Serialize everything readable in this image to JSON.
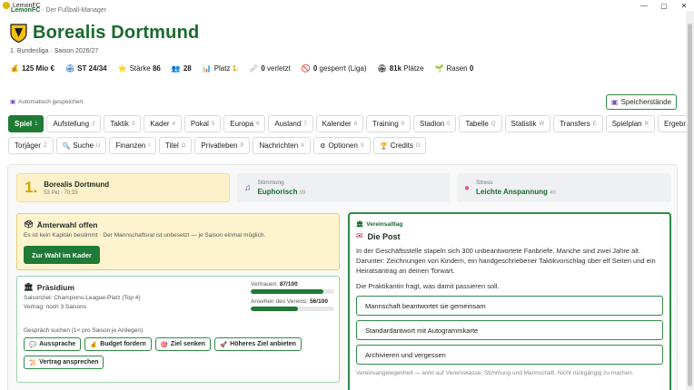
{
  "window": {
    "title": "LemonFC",
    "min": "—",
    "max": "▢",
    "close": "✕"
  },
  "brand": {
    "name": "LemonFC",
    "tagline": "· Der Fußball-Manager"
  },
  "club": {
    "name": "Borealis Dortmund",
    "league_season": "1. Bundesliga · Saison 2026/27"
  },
  "stats": [
    {
      "icon": "money-bag-icon",
      "glyph": "💰",
      "value": "125 Mio €",
      "label": ""
    },
    {
      "icon": "stadium-icon",
      "glyph": "🏟",
      "value": "ST 24/34",
      "label": ""
    },
    {
      "icon": "star-icon",
      "glyph": "⭐",
      "value": "86",
      "label": "Stärke"
    },
    {
      "icon": "players-icon",
      "glyph": "👥",
      "value": "28",
      "label": ""
    },
    {
      "icon": "chart-icon",
      "glyph": "📊",
      "value": "1.",
      "label": "Platz"
    },
    {
      "icon": "injury-icon",
      "glyph": "🩹",
      "value": "0",
      "label": "verletzt"
    },
    {
      "icon": "ban-icon",
      "glyph": "🚫",
      "value": "0",
      "label": "gesperrt (Liga)"
    },
    {
      "icon": "seats-icon",
      "glyph": "🏟",
      "value": "81k",
      "label": "Plätze"
    },
    {
      "icon": "grass-icon",
      "glyph": "🌱",
      "value": "0",
      "label": "Rasen"
    }
  ],
  "autosave": "Automatisch gespeichert",
  "save_button": "Speicherstände",
  "nav_row1": [
    {
      "label": "Spiel",
      "key": "1",
      "active": true
    },
    {
      "label": "Aufstellung",
      "key": "2"
    },
    {
      "label": "Taktik",
      "key": "3"
    },
    {
      "label": "Kader",
      "key": "4"
    },
    {
      "label": "Pokal",
      "key": "5"
    },
    {
      "label": "Europa",
      "key": "6"
    },
    {
      "label": "Ausland",
      "key": "7"
    },
    {
      "label": "Kalender",
      "key": "8"
    },
    {
      "label": "Training",
      "key": "9"
    },
    {
      "label": "Stadion",
      "key": "0"
    },
    {
      "label": "Tabelle",
      "key": "Q"
    },
    {
      "label": "Statistik",
      "key": "W"
    },
    {
      "label": "Transfers",
      "key": "E"
    },
    {
      "label": "Spielplan",
      "key": "R"
    },
    {
      "label": "Ergebnisse",
      "key": "T"
    }
  ],
  "nav_row2": [
    {
      "label": "Torjäger",
      "key": "Z",
      "glyph": ""
    },
    {
      "label": "Suche",
      "key": "U",
      "glyph": "🔍"
    },
    {
      "label": "Finanzen",
      "key": "I",
      "glyph": ""
    },
    {
      "label": "Titel",
      "key": "O",
      "glyph": ""
    },
    {
      "label": "Privatleben",
      "key": "P",
      "glyph": ""
    },
    {
      "label": "Nachrichten",
      "key": "A",
      "glyph": ""
    },
    {
      "label": "Optionen",
      "key": "S",
      "glyph": "⚙"
    },
    {
      "label": "Credits",
      "key": "D",
      "glyph": "🏆"
    }
  ],
  "cards": {
    "rank": {
      "num": "1.",
      "club": "Borealis Dortmund",
      "meta": "53 Pkt · 70:33"
    },
    "mood": {
      "label": "Stimmung",
      "value": "Euphorisch",
      "score": "99"
    },
    "stress": {
      "label": "Stress",
      "value": "Leichte Anspannung",
      "score": "40"
    }
  },
  "election": {
    "title": "Ämterwahl offen",
    "text": "Es ist kein Kapitän bestimmt · Der Mannschaftsrat ist unbesetzt — je Saison einmal möglich.",
    "button": "Zur Wahl im Kader"
  },
  "presidium": {
    "title": "Präsidium",
    "goal": "Saisonziel: Champions-League-Platz (Top 4)",
    "contract": "Vertrag: noch 3 Saisons",
    "trust_label": "Vertrauen:",
    "trust_value": "87/100",
    "trust": 87,
    "reputation_label": "Ansehen des Vereins:",
    "reputation_value": "56/100",
    "reputation": 56,
    "talk": "Gespräch suchen (1× pro Saison je Anliegen):",
    "actions": [
      {
        "label": "Aussprache",
        "glyph": "💬"
      },
      {
        "label": "Budget fordern",
        "glyph": "💰"
      },
      {
        "label": "Ziel senken",
        "glyph": "🎯"
      },
      {
        "label": "Höheres Ziel anbieten",
        "glyph": "🚀"
      },
      {
        "label": "Vertrag ansprechen",
        "glyph": "📜"
      }
    ]
  },
  "event": {
    "kicker": "Vereinsalltag",
    "title": "Die Post",
    "story": "In der Geschäftsstelle stapeln sich 300 unbeantwortete Fanbriefe. Manche sind zwei Jahre alt. Darunter: Zeichnungen von Kindern, ein handgeschriebener Taktikvorschlag über elf Seiten und ein Heiratsantrag an deinen Torwart.",
    "question": "Die Praktikantin fragt, was damit passieren soll.",
    "choices": [
      "Mannschaft beantwortet sie gemeinsam",
      "Standardantwort mit Autogrammkarte",
      "Archivieren und vergessen"
    ],
    "note": "Vereinsangelegenheit — wirkt auf Vereinskasse, Stimmung und Mannschaft. Nicht rückgängig zu machen."
  }
}
